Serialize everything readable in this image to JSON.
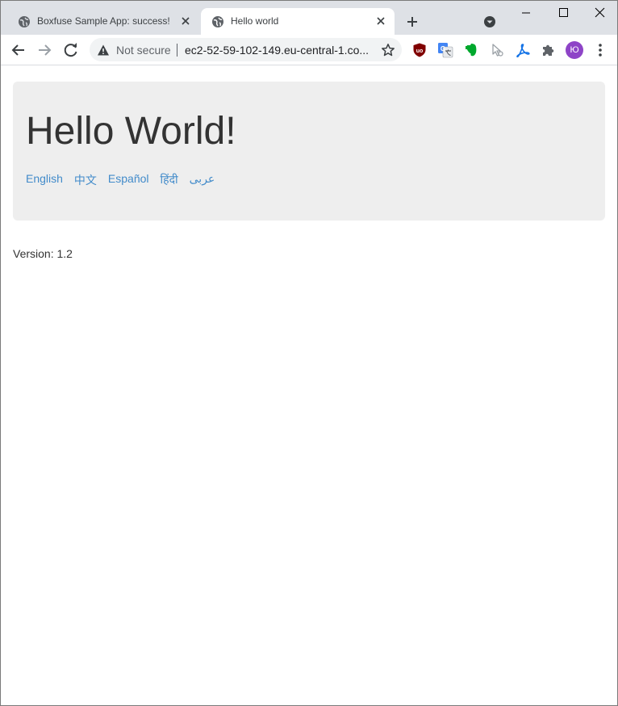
{
  "tabs": [
    {
      "title": "Boxfuse Sample App: success!",
      "active": false
    },
    {
      "title": "Hello world",
      "active": true
    }
  ],
  "address_bar": {
    "security_label": "Not secure",
    "url": "ec2-52-59-102-149.eu-central-1.co..."
  },
  "profile": {
    "initials": "Ю"
  },
  "page": {
    "heading": "Hello World!",
    "languages": [
      "English",
      "中文",
      "Español",
      "हिंदी",
      "عربى"
    ],
    "version": "Version: 1.2"
  },
  "colors": {
    "link": "#428bca",
    "jumbotron_bg": "#eeeeee",
    "tabstrip_bg": "#dee1e6",
    "avatar_bg": "#8e44c7"
  },
  "icons": {
    "favicon": "globe-icon",
    "extensions": [
      "ublock-icon",
      "google-translate-icon",
      "evernote-icon",
      "cursor-icon",
      "acrobat-icon",
      "puzzle-icon"
    ]
  }
}
